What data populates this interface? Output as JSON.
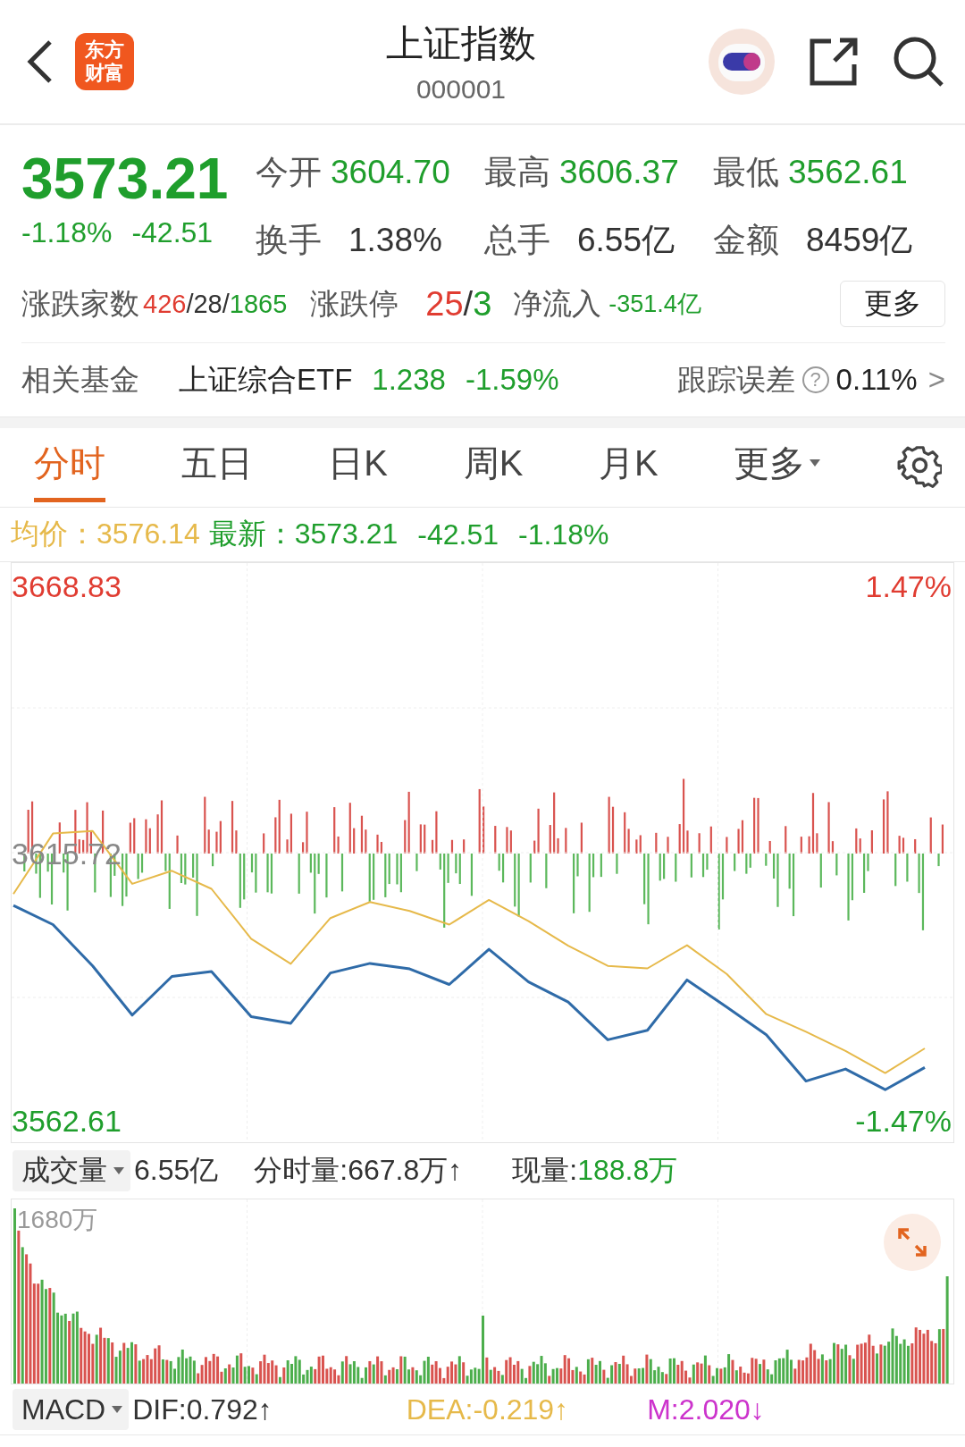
{
  "header": {
    "logo_text": "东方财富",
    "title": "上证指数",
    "code": "000001"
  },
  "quote": {
    "price": "3573.21",
    "change_pct": "-1.18%",
    "change": "-42.51",
    "stats": [
      {
        "label": "今开",
        "value": "3604.70",
        "color": "#1f9e2c"
      },
      {
        "label": "最高",
        "value": "3606.37",
        "color": "#1f9e2c"
      },
      {
        "label": "最低",
        "value": "3562.61",
        "color": "#1f9e2c"
      },
      {
        "label": "换手",
        "value": "1.38%",
        "color": "#333333"
      },
      {
        "label": "总手",
        "value": "6.55亿",
        "color": "#333333"
      },
      {
        "label": "金额",
        "value": "8459亿",
        "color": "#333333"
      }
    ],
    "breadth": {
      "label": "涨跌家数",
      "parts": [
        {
          "text": "426",
          "color": "#e03c31"
        },
        {
          "text": "/",
          "color": "#333333"
        },
        {
          "text": "28",
          "color": "#333333"
        },
        {
          "text": "/",
          "color": "#333333"
        },
        {
          "text": "1865",
          "color": "#1f9e2c"
        }
      ]
    },
    "limits": {
      "label": "涨跌停",
      "parts": [
        {
          "text": "25",
          "color": "#e03c31"
        },
        {
          "text": "/",
          "color": "#333333"
        },
        {
          "text": "3",
          "color": "#1f9e2c"
        }
      ]
    },
    "net_inflow": {
      "label": "净流入",
      "value": "-351.4亿"
    },
    "more_button": "更多"
  },
  "fund": {
    "label": "相关基金",
    "name": "上证综合ETF",
    "price": "1.238",
    "change": "-1.59%",
    "tracking_label": "跟踪误差",
    "help": "?",
    "tracking_value": "0.11%",
    "chevron": ">"
  },
  "tabs": [
    {
      "label": "分时",
      "selected": true,
      "kind": "tab"
    },
    {
      "label": "五日",
      "selected": false,
      "kind": "tab"
    },
    {
      "label": "日K",
      "selected": false,
      "kind": "tab"
    },
    {
      "label": "周K",
      "selected": false,
      "kind": "tab"
    },
    {
      "label": "月K",
      "selected": false,
      "kind": "tab"
    },
    {
      "label": "更多",
      "selected": false,
      "kind": "dropdown"
    }
  ],
  "info_bar": {
    "avg_label": "均价：",
    "avg_value": "3576.14",
    "latest_label": "最新：",
    "latest_value": "3573.21",
    "change": "-42.51",
    "change_pct": "-1.18%"
  },
  "price_chart": {
    "right_top_label": "1.47%",
    "right_bottom_label": "-1.47%",
    "chart_data": {
      "type": "line",
      "categories": [
        null,
        null,
        null,
        null,
        null,
        null,
        null,
        null,
        null,
        null,
        null,
        null,
        null,
        null,
        null,
        null,
        null,
        null,
        null,
        null,
        null,
        null,
        null,
        null
      ],
      "ylim": [
        3558.35,
        3673.45
      ],
      "yticks": [
        {
          "value": 3668.83,
          "label": "3668.83"
        },
        {
          "value": 3615.72,
          "label": "3615.72"
        },
        {
          "value": 3562.61,
          "label": "3562.61"
        }
      ],
      "series": [
        {
          "color": "#2f6ba8",
          "values": [
            3605.4,
            3601.6,
            3593.4,
            3583.6,
            3591.3,
            3592.3,
            3583.3,
            3582.0,
            3592.0,
            3593.9,
            3592.8,
            3589.7,
            3596.7,
            3590.2,
            3586.2,
            3578.7,
            3580.6,
            3590.6,
            3585.2,
            3579.7,
            3570.5,
            3572.9,
            3568.8,
            3573.2
          ]
        },
        {
          "color": "#e6b94a",
          "values": [
            3607.7,
            3619.7,
            3620.2,
            3609.7,
            3612.3,
            3608.7,
            3598.8,
            3593.8,
            3602.9,
            3606.1,
            3604.3,
            3601.6,
            3606.5,
            3602.3,
            3597.4,
            3593.4,
            3592.9,
            3597.5,
            3591.8,
            3583.8,
            3580.3,
            3576.5,
            3572.1,
            3577.0
          ]
        }
      ]
    }
  },
  "volume": {
    "selector": "成交量",
    "total": "6.55亿",
    "period": "分时量:667.8万↑",
    "current_label": "现量:",
    "current_value": "188.8万",
    "max_label": "1680万"
  },
  "macd": {
    "selector": "MACD",
    "items": [
      {
        "text": "DIF:0.792↑",
        "color": "#333333"
      },
      {
        "text": "DEA:-0.219↑",
        "color": "#e6b94a"
      },
      {
        "text": "M:2.020↓",
        "color": "#cc33cc"
      }
    ]
  }
}
